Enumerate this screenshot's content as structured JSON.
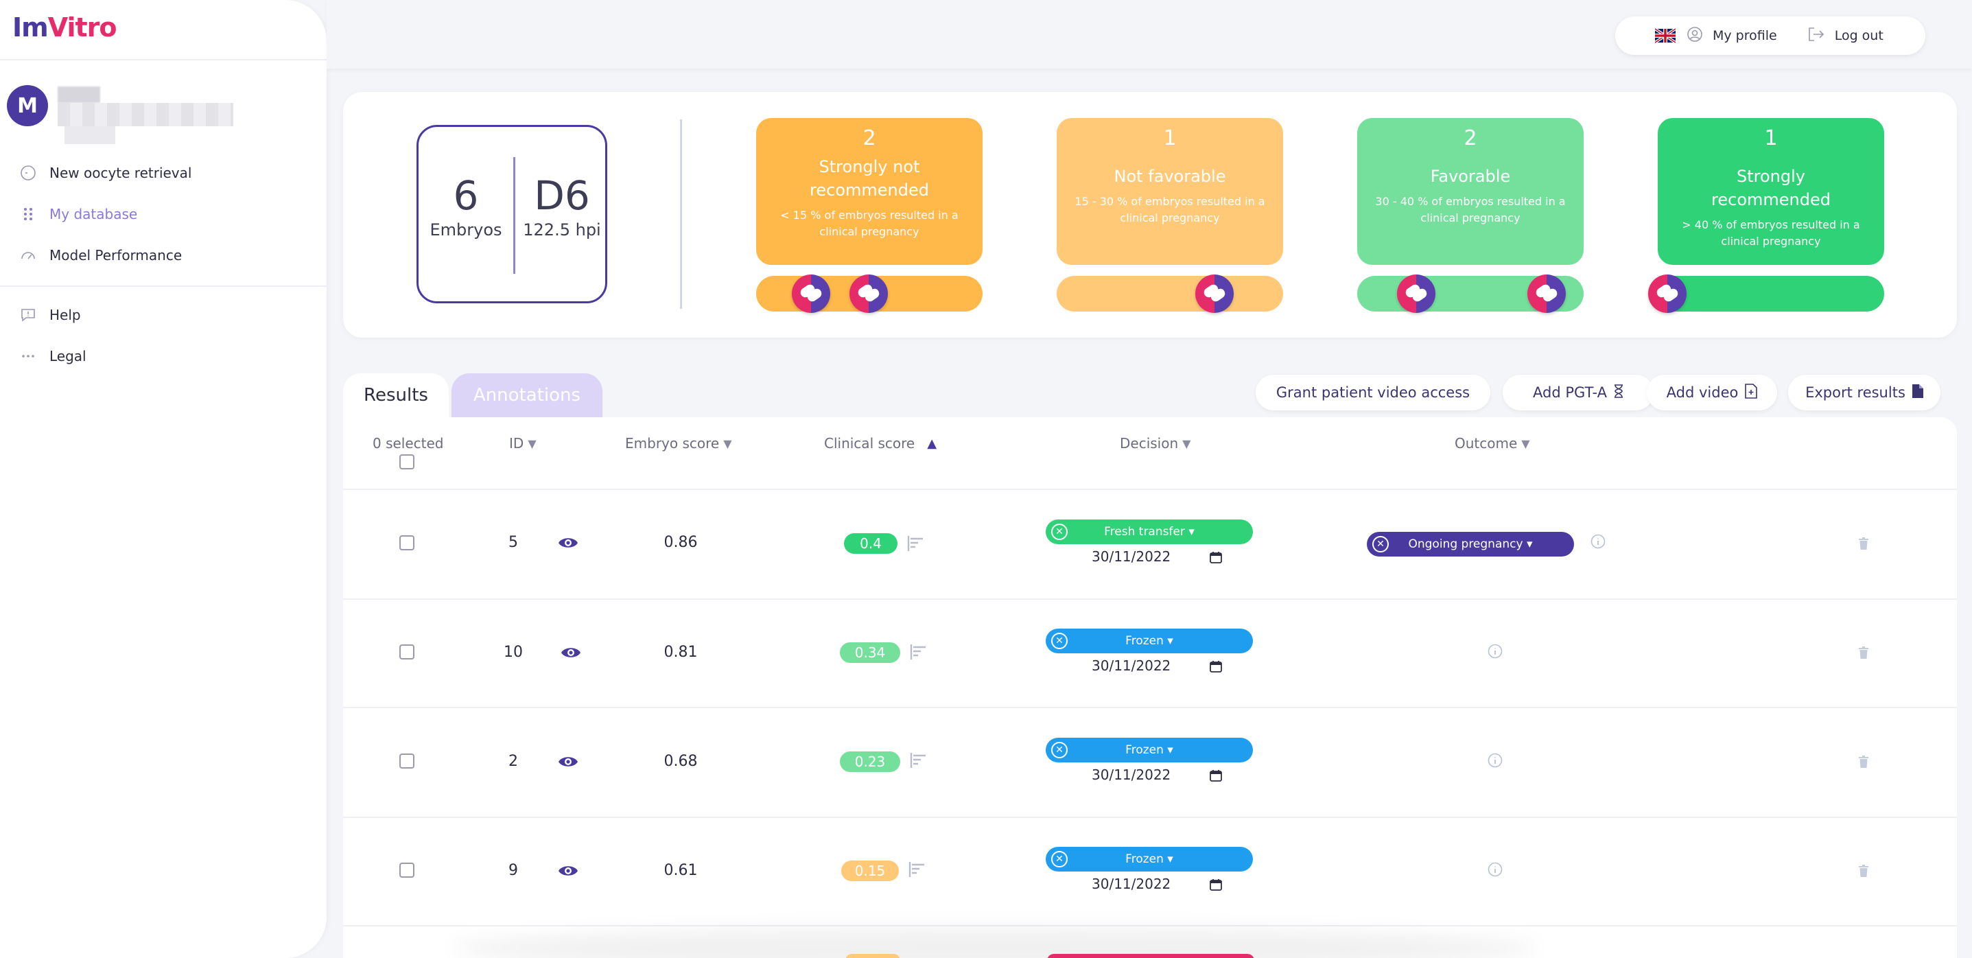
{
  "brand": {
    "logo_part1": "Im",
    "logo_part2": "Vitro",
    "avatar_initial": "M"
  },
  "sidebar": {
    "items": [
      {
        "label": "New oocyte retrieval",
        "icon": "circle-dashed-icon"
      },
      {
        "label": "My database",
        "icon": "grid-dots-icon",
        "active": true
      },
      {
        "label": "Model Performance",
        "icon": "gauge-icon"
      },
      {
        "label": "Help",
        "icon": "chat-alert-icon"
      },
      {
        "label": "Legal",
        "icon": "dots-icon"
      }
    ]
  },
  "header": {
    "language": "en-gb",
    "my_profile": "My profile",
    "logout": "Log out"
  },
  "summary": {
    "embryos_count": "6",
    "embryos_label": "Embryos",
    "day": "D6",
    "hpi": "122.5 hpi",
    "categories": [
      {
        "count": "2",
        "title": "Strongly not recommended",
        "desc": "< 15 % of embryos resulted in a clinical pregnancy",
        "color": "#ffb84a",
        "bar_color": "#ffb84a"
      },
      {
        "count": "1",
        "title": "Not favorable",
        "desc": "15 - 30 % of embryos resulted in a clinical pregnancy",
        "color": "#ffc978",
        "bar_color": "#ffc978"
      },
      {
        "count": "2",
        "title": "Favorable",
        "desc": "30 - 40 % of embryos resulted in a clinical pregnancy",
        "color": "#75e09c",
        "bar_color": "#75e09c"
      },
      {
        "count": "1",
        "title": "Strongly recommended",
        "desc": "> 40 % of embryos resulted in a clinical pregnancy",
        "color": "#2fd277",
        "bar_color": "#2fd277"
      }
    ]
  },
  "tabs": {
    "results": "Results",
    "annotations": "Annotations"
  },
  "actions": {
    "grant": "Grant patient video access",
    "add_pgta": "Add PGT-A",
    "add_video": "Add video",
    "export": "Export results"
  },
  "table": {
    "selected": "0 selected",
    "columns": {
      "id": "ID",
      "embryo_score": "Embryo score",
      "clinical_score": "Clinical score",
      "decision": "Decision",
      "outcome": "Outcome"
    },
    "rows": [
      {
        "id": "5",
        "embryo_score": "0.86",
        "clinical_score": "0.4",
        "clinical_color": "#2fd277",
        "decision": "Fresh transfer ▾",
        "decision_color": "#2fd277",
        "date": "30/11/2022",
        "outcome": "Ongoing pregnancy ▾"
      },
      {
        "id": "10",
        "embryo_score": "0.81",
        "clinical_score": "0.34",
        "clinical_color": "#75e09c",
        "decision": "Frozen ▾",
        "decision_color": "#1f9ef0",
        "date": "30/11/2022",
        "outcome": ""
      },
      {
        "id": "2",
        "embryo_score": "0.68",
        "clinical_score": "0.23",
        "clinical_color": "#75e09c",
        "decision": "Frozen ▾",
        "decision_color": "#1f9ef0",
        "date": "30/11/2022",
        "outcome": ""
      },
      {
        "id": "9",
        "embryo_score": "0.61",
        "clinical_score": "0.15",
        "clinical_color": "#ffc978",
        "decision": "Frozen ▾",
        "decision_color": "#1f9ef0",
        "date": "30/11/2022",
        "outcome": ""
      }
    ]
  }
}
